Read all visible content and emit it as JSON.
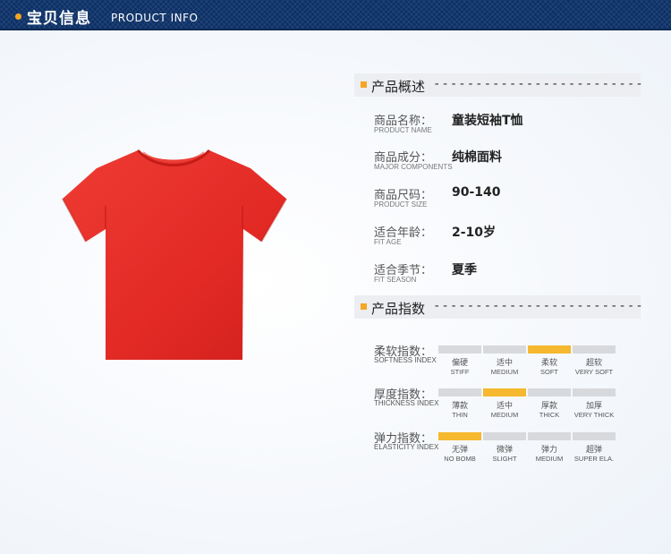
{
  "header": {
    "title_cn": "宝贝信息",
    "title_en": "PRODUCT INFO",
    "accent_color": "#f5a623",
    "bg_color": "#0d3167"
  },
  "product_image": {
    "subject": "red-tshirt",
    "color": "#e82a2a"
  },
  "overview": {
    "label": "产品概述",
    "dashes": "-------------------------",
    "rows": [
      {
        "key_cn": "商品名称：",
        "key_en": "PRODUCT NAME",
        "value": "童装短袖T恤"
      },
      {
        "key_cn": "商品成分：",
        "key_en": "MAJOR COMPONENTS",
        "value": "纯棉面料"
      },
      {
        "key_cn": "商品尺码：",
        "key_en": "PRODUCT SIZE",
        "value": "90-140"
      },
      {
        "key_cn": "适合年龄：",
        "key_en": "FIT AGE",
        "value": "2-10岁"
      },
      {
        "key_cn": "适合季节：",
        "key_en": "FIT SEASON",
        "value": "夏季"
      }
    ]
  },
  "indices": {
    "label": "产品指数",
    "dashes": "-------------------------",
    "rows": [
      {
        "key_cn": "柔软指数：",
        "key_en": "SOFTNESS INDEX",
        "selected": 2,
        "options": [
          {
            "cn": "偏硬",
            "en": "STIFF"
          },
          {
            "cn": "适中",
            "en": "MEDIUM"
          },
          {
            "cn": "柔软",
            "en": "SOFT"
          },
          {
            "cn": "超软",
            "en": "VERY SOFT"
          }
        ]
      },
      {
        "key_cn": "厚度指数：",
        "key_en": "THICKNESS INDEX",
        "selected": 1,
        "options": [
          {
            "cn": "薄款",
            "en": "THIN"
          },
          {
            "cn": "适中",
            "en": "MEDIUM"
          },
          {
            "cn": "厚款",
            "en": "THICK"
          },
          {
            "cn": "加厚",
            "en": "VERY THICK"
          }
        ]
      },
      {
        "key_cn": "弹力指数：",
        "key_en": "ELASTICITY INDEX",
        "selected": 0,
        "options": [
          {
            "cn": "无弹",
            "en": "NO BOMB"
          },
          {
            "cn": "微弹",
            "en": "SLIGHT"
          },
          {
            "cn": "弹力",
            "en": "MEDIUM"
          },
          {
            "cn": "超弹",
            "en": "SUPER ELA."
          }
        ]
      }
    ],
    "active_color": "#f5b82e",
    "inactive_color": "#d8d9dc"
  }
}
